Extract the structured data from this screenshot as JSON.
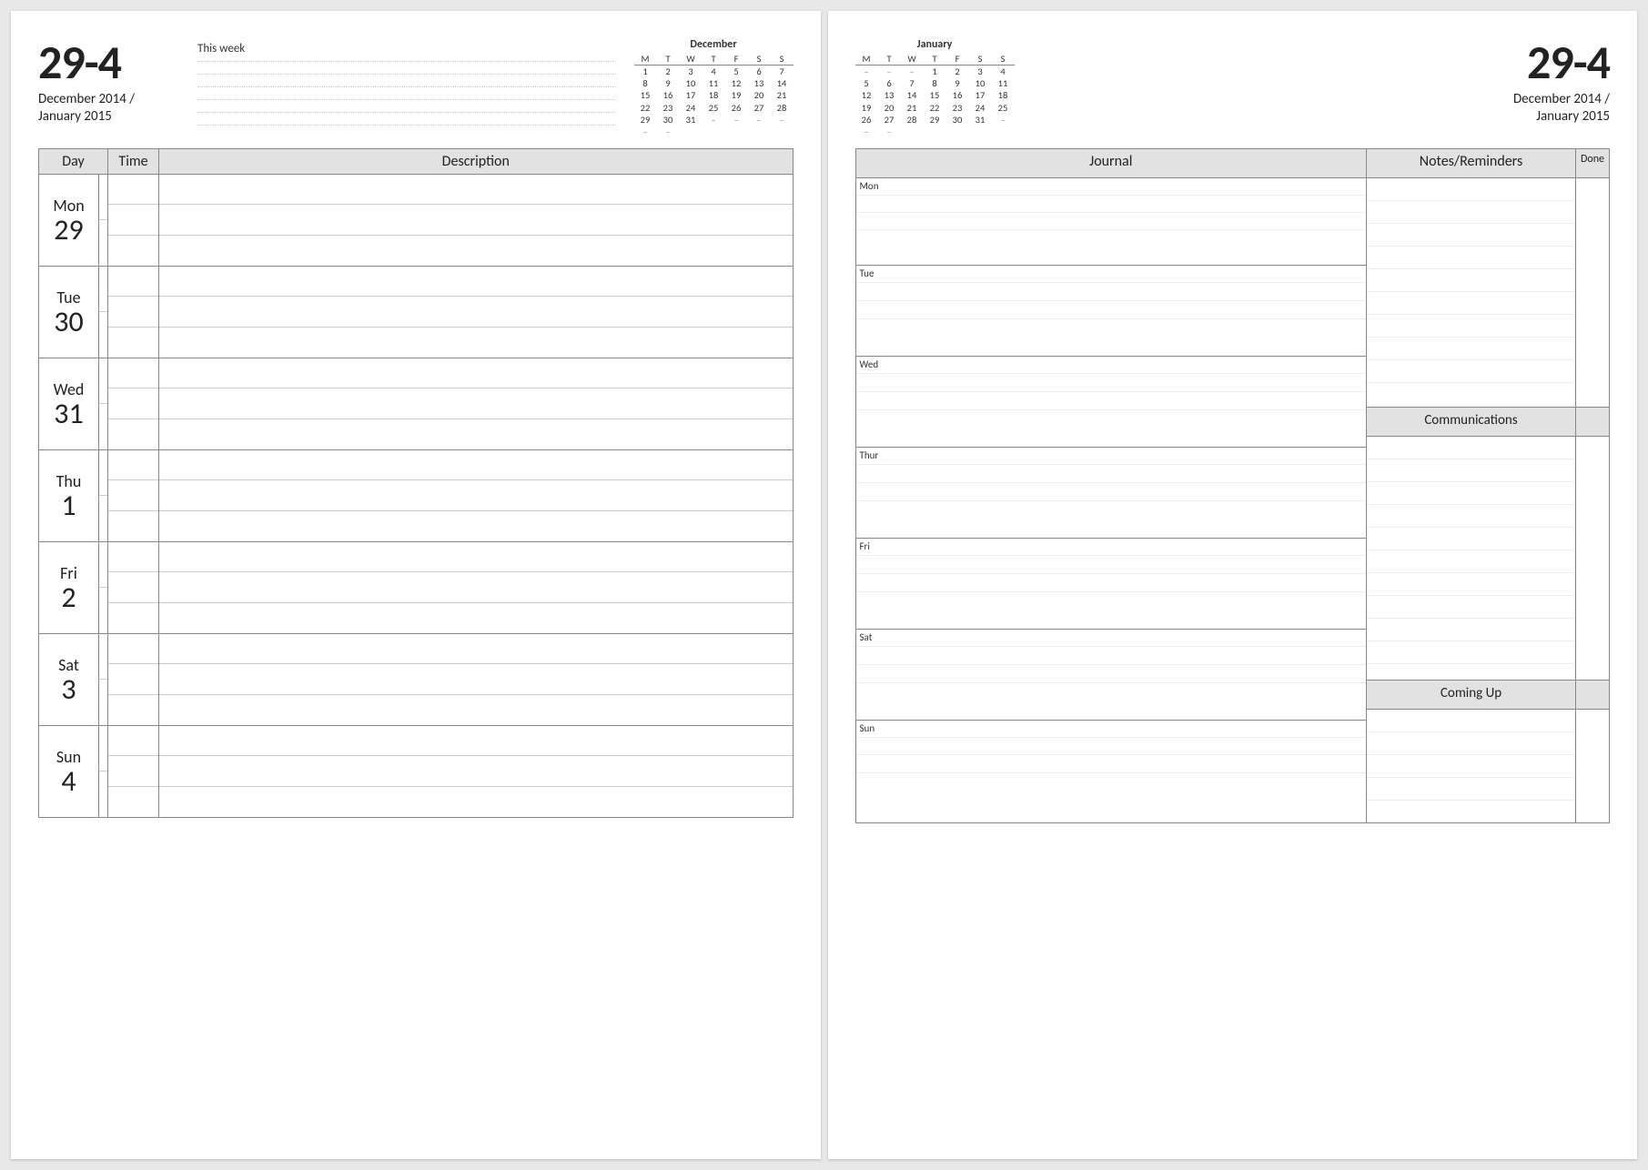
{
  "week_range": "29-4",
  "date_sub_line1": "December 2014 /",
  "date_sub_line2": "January 2015",
  "this_week_label": "This week",
  "mini_calendars": {
    "dow_headers": [
      "M",
      "T",
      "W",
      "T",
      "F",
      "S",
      "S"
    ],
    "left": {
      "title": "December",
      "rows": [
        [
          "1",
          "2",
          "3",
          "4",
          "5",
          "6",
          "7"
        ],
        [
          "8",
          "9",
          "10",
          "11",
          "12",
          "13",
          "14"
        ],
        [
          "15",
          "16",
          "17",
          "18",
          "19",
          "20",
          "21"
        ],
        [
          "22",
          "23",
          "24",
          "25",
          "26",
          "27",
          "28"
        ],
        [
          "29",
          "30",
          "31",
          "–",
          "–",
          "–",
          "–"
        ],
        [
          "–",
          "–",
          "",
          "",
          "",
          "",
          ""
        ]
      ]
    },
    "right": {
      "title": "January",
      "rows": [
        [
          "–",
          "–",
          "–",
          "1",
          "2",
          "3",
          "4"
        ],
        [
          "5",
          "6",
          "7",
          "8",
          "9",
          "10",
          "11"
        ],
        [
          "12",
          "13",
          "14",
          "15",
          "16",
          "17",
          "18"
        ],
        [
          "19",
          "20",
          "21",
          "22",
          "23",
          "24",
          "25"
        ],
        [
          "26",
          "27",
          "28",
          "29",
          "30",
          "31",
          "–"
        ],
        [
          "–",
          "–",
          "",
          "",
          "",
          "",
          ""
        ]
      ]
    }
  },
  "schedule": {
    "headers": {
      "day": "Day",
      "time": "Time",
      "desc": "Description"
    },
    "days": [
      {
        "dow": "Mon",
        "num": "29"
      },
      {
        "dow": "Tue",
        "num": "30"
      },
      {
        "dow": "Wed",
        "num": "31"
      },
      {
        "dow": "Thu",
        "num": "1"
      },
      {
        "dow": "Fri",
        "num": "2"
      },
      {
        "dow": "Sat",
        "num": "3"
      },
      {
        "dow": "Sun",
        "num": "4"
      }
    ]
  },
  "right_page": {
    "headers": {
      "journal": "Journal",
      "notes": "Notes/Reminders",
      "done": "Done"
    },
    "journal_days": [
      "Mon",
      "Tue",
      "Wed",
      "Thur",
      "Fri",
      "Sat",
      "Sun"
    ],
    "side_sections": {
      "communications": "Communications",
      "coming_up": "Coming Up"
    }
  }
}
